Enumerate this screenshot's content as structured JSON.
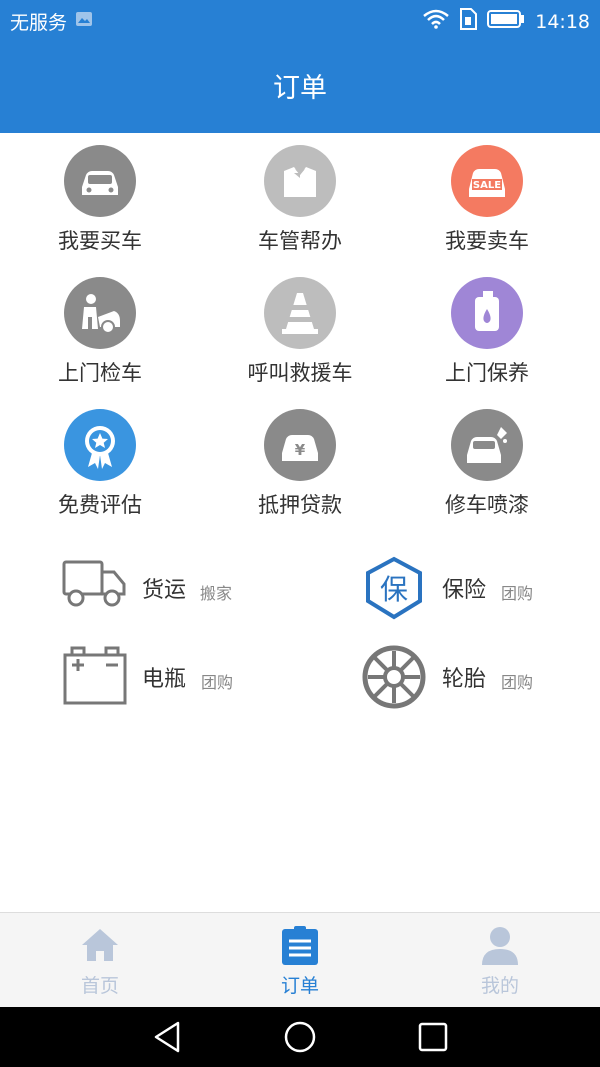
{
  "status": {
    "carrier": "无服务",
    "time": "14:18"
  },
  "header": {
    "title": "订单"
  },
  "services": [
    {
      "label": "我要买车",
      "icon": "car-icon",
      "color": "#8a8a8a"
    },
    {
      "label": "车管帮办",
      "icon": "suit-icon",
      "color": "#bdbdbd"
    },
    {
      "label": "我要卖车",
      "icon": "sale-car-icon",
      "color": "#f47a61"
    },
    {
      "label": "上门检车",
      "icon": "mechanic-icon",
      "color": "#8a8a8a"
    },
    {
      "label": "呼叫救援车",
      "icon": "traffic-cone-icon",
      "color": "#bdbdbd"
    },
    {
      "label": "上门保养",
      "icon": "oil-can-icon",
      "color": "#9f86d6"
    },
    {
      "label": "免费评估",
      "icon": "award-badge-icon",
      "color": "#3a95e0"
    },
    {
      "label": "抵押贷款",
      "icon": "loan-car-icon",
      "color": "#8a8a8a"
    },
    {
      "label": "修车喷漆",
      "icon": "paint-car-icon",
      "color": "#8a8a8a"
    }
  ],
  "extras": [
    {
      "name": "货运",
      "tag": "搬家",
      "icon": "truck-icon"
    },
    {
      "name": "保险",
      "tag": "团购",
      "icon": "insurance-icon",
      "icon_text": "保"
    },
    {
      "name": "电瓶",
      "tag": "团购",
      "icon": "battery-icon"
    },
    {
      "name": "轮胎",
      "tag": "团购",
      "icon": "tire-icon"
    }
  ],
  "tabs": [
    {
      "label": "首页",
      "icon": "home-icon",
      "active": false
    },
    {
      "label": "订单",
      "icon": "clipboard-icon",
      "active": true
    },
    {
      "label": "我的",
      "icon": "user-icon",
      "active": false
    }
  ],
  "colors": {
    "primary": "#2780d4",
    "inactive_tab": "#b9c6da",
    "accent_blue": "#2a73c0"
  }
}
